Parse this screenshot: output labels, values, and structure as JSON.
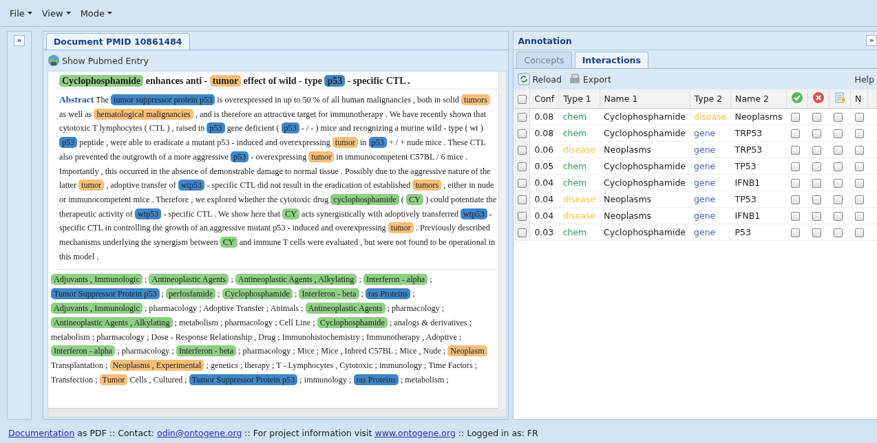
{
  "menu": [
    "File",
    "View",
    "Mode"
  ],
  "left_panel": {
    "expand_button": "»"
  },
  "document": {
    "tab": {
      "label": "Document PMID 10861484",
      "selected": true
    },
    "pubmed_button": "Show Pubmed Entry",
    "title": [
      {
        "text": "Cyclophosphamide",
        "kind": "chem"
      },
      {
        "text": "enhances anti -",
        "kind": "text"
      },
      {
        "text": "tumor",
        "kind": "disease"
      },
      {
        "text": "effect of wild - type",
        "kind": "text"
      },
      {
        "text": "p53",
        "kind": "gene"
      },
      {
        "text": "- specific   CTL   .",
        "kind": "text"
      }
    ],
    "abstract_label": "Abstract",
    "abstract": [
      {
        "text": "The",
        "kind": "text"
      },
      {
        "text": "tumor suppressor protein p53",
        "kind": "gene"
      },
      {
        "text": "is overexpressed in up to 50 % of all human malignancies , both in solid",
        "kind": "text"
      },
      {
        "text": "tumors",
        "kind": "disease"
      },
      {
        "text": "as well as",
        "kind": "text"
      },
      {
        "text": "hematological malignancies",
        "kind": "disease"
      },
      {
        "text": ", and is therefore an attractive target for immunotherapy . We have recently shown that cytotoxic T lymphocytes (   CTL   ) , raised in",
        "kind": "text"
      },
      {
        "text": "p53",
        "kind": "gene"
      },
      {
        "text": "gene deficient (",
        "kind": "text"
      },
      {
        "text": "p53",
        "kind": "gene"
      },
      {
        "text": "- / - ) mice and recognizing a murine wild - type ( wt )",
        "kind": "text"
      },
      {
        "text": "p53",
        "kind": "gene"
      },
      {
        "text": "peptide , were able to eradicate a mutant   p53   - induced and overexpressing",
        "kind": "text"
      },
      {
        "text": "tumor",
        "kind": "disease"
      },
      {
        "text": "in",
        "kind": "text"
      },
      {
        "text": "p53",
        "kind": "gene"
      },
      {
        "text": "+ / + nude mice . These   CTL   also prevented the outgrowth of a more aggressive",
        "kind": "text"
      },
      {
        "text": "p53",
        "kind": "gene"
      },
      {
        "text": "- overexpressing",
        "kind": "text"
      },
      {
        "text": "tumor",
        "kind": "disease"
      },
      {
        "text": "in immunocompetent C57BL / 6 mice . Importantly , this occurred in the absence of demonstrable damage to normal tissue . Possibly due to the aggressive nature of the latter",
        "kind": "text"
      },
      {
        "text": "tumor",
        "kind": "disease"
      },
      {
        "text": ", adoptive transfer of",
        "kind": "text"
      },
      {
        "text": "wtp53",
        "kind": "gene"
      },
      {
        "text": "- specific   CTL   did not result in the eradication of established",
        "kind": "text"
      },
      {
        "text": "tumors",
        "kind": "disease"
      },
      {
        "text": ", either in nude or immunocompetent mice . Therefore , we explored whether the cytotoxic drug",
        "kind": "text"
      },
      {
        "text": "cyclophosphamide",
        "kind": "chem"
      },
      {
        "text": "(",
        "kind": "text"
      },
      {
        "text": "CY",
        "kind": "chem"
      },
      {
        "text": ") could potentiate the therapeutic activity of",
        "kind": "text"
      },
      {
        "text": "wtp53",
        "kind": "gene"
      },
      {
        "text": "- specific   CTL   . We show here that",
        "kind": "text"
      },
      {
        "text": "CY",
        "kind": "chem"
      },
      {
        "text": "acts synergistically with adoptively transferred",
        "kind": "text"
      },
      {
        "text": "wtp53",
        "kind": "gene"
      },
      {
        "text": "- specific   CTL   in controlling the growth of an aggressive mutant p53 - induced and overexpressing",
        "kind": "text"
      },
      {
        "text": "tumor",
        "kind": "disease"
      },
      {
        "text": ". Previously described mechanisms underlying the synergism between",
        "kind": "text"
      },
      {
        "text": "CY",
        "kind": "chem"
      },
      {
        "text": "and immune T cells were evaluated , but were not found to be operational in this model .",
        "kind": "text"
      }
    ],
    "keywords": [
      {
        "text": "Adjuvants , Immunologic",
        "kind": "chem"
      },
      {
        "text": ";",
        "kind": "text"
      },
      {
        "text": "Antineoplastic Agents",
        "kind": "chem"
      },
      {
        "text": ";",
        "kind": "text"
      },
      {
        "text": "Antineoplastic Agents , Alkylating",
        "kind": "chem"
      },
      {
        "text": ";",
        "kind": "text"
      },
      {
        "text": "Interferon - alpha",
        "kind": "chem"
      },
      {
        "text": ";",
        "kind": "text"
      },
      {
        "text": "Tumor Suppressor Protein p53",
        "kind": "gene"
      },
      {
        "text": ";",
        "kind": "text"
      },
      {
        "text": "perfosfamide",
        "kind": "chem"
      },
      {
        "text": ";",
        "kind": "text"
      },
      {
        "text": "Cyclophosphamide",
        "kind": "chem"
      },
      {
        "text": ";",
        "kind": "text"
      },
      {
        "text": "Interferon - beta",
        "kind": "chem"
      },
      {
        "text": ";",
        "kind": "text"
      },
      {
        "text": "ras Proteins",
        "kind": "gene"
      },
      {
        "text": ";",
        "kind": "text"
      },
      {
        "text": "Adjuvants , Immunologic",
        "kind": "chem"
      },
      {
        "text": "; pharmacology ; Adoptive Transfer ; Animals ;",
        "kind": "text"
      },
      {
        "text": "Antineoplastic Agents",
        "kind": "chem"
      },
      {
        "text": "; pharmacology ;",
        "kind": "text"
      },
      {
        "text": "Antineoplastic Agents , Alkylating",
        "kind": "chem"
      },
      {
        "text": "; metabolism ; pharmacology ; Cell Line ;",
        "kind": "text"
      },
      {
        "text": "Cyclophosphamide",
        "kind": "chem"
      },
      {
        "text": "; analogs & derivatives ; metabolism ; pharmacology ; Dose - Response Relationship , Drug ; Immunohistochemistry ; Immunotherapy , Adoptive ;",
        "kind": "text"
      },
      {
        "text": "Interferon - alpha",
        "kind": "chem"
      },
      {
        "text": "; pharmacology ;",
        "kind": "text"
      },
      {
        "text": "Interferon - beta",
        "kind": "chem"
      },
      {
        "text": "; pharmacology ; Mice ; Mice , Inbred C57BL ; Mice , Nude ;",
        "kind": "text"
      },
      {
        "text": "Neoplasm",
        "kind": "disease"
      },
      {
        "text": "Transplantation ;",
        "kind": "text"
      },
      {
        "text": "Neoplasms , Experimental",
        "kind": "disease"
      },
      {
        "text": "; genetics ; therapy ; T - Lymphocytes , Cytotoxic ; immunology ; Time Factors ; Transfection ;",
        "kind": "text"
      },
      {
        "text": "Tumor",
        "kind": "disease"
      },
      {
        "text": "Cells , Cultured ;",
        "kind": "text"
      },
      {
        "text": "Tumor Suppressor Protein p53",
        "kind": "gene"
      },
      {
        "text": "; immunology ;",
        "kind": "text"
      },
      {
        "text": "ras Proteins",
        "kind": "gene"
      },
      {
        "text": "; metabolism ;",
        "kind": "text"
      }
    ]
  },
  "annotation": {
    "title": "Annotation",
    "expand_button": "»",
    "tabs": [
      {
        "label": "Concepts",
        "selected": false
      },
      {
        "label": "Interactions",
        "selected": true
      }
    ],
    "toolbar": {
      "reload": "Reload",
      "export": "Export",
      "help": "Help"
    },
    "table": {
      "all_selected": false,
      "columns": [
        "Conf",
        "Type 1",
        "Name 1",
        "Type 2",
        "Name 2",
        "N"
      ],
      "rows": [
        {
          "selected": false,
          "conf": "0.08",
          "type1": "chem",
          "name1": "Cyclophosphamide",
          "type2": "disease",
          "name2": "Neoplasms",
          "checks": [
            false,
            false,
            false,
            false
          ]
        },
        {
          "selected": false,
          "conf": "0.08",
          "type1": "chem",
          "name1": "Cyclophosphamide",
          "type2": "gene",
          "name2": "TRP53",
          "checks": [
            false,
            false,
            false,
            false
          ]
        },
        {
          "selected": false,
          "conf": "0.06",
          "type1": "disease",
          "name1": "Neoplasms",
          "type2": "gene",
          "name2": "TRP53",
          "checks": [
            false,
            false,
            false,
            false
          ]
        },
        {
          "selected": false,
          "conf": "0.05",
          "type1": "chem",
          "name1": "Cyclophosphamide",
          "type2": "gene",
          "name2": "TP53",
          "checks": [
            false,
            false,
            false,
            false
          ]
        },
        {
          "selected": false,
          "conf": "0.04",
          "type1": "chem",
          "name1": "Cyclophosphamide",
          "type2": "gene",
          "name2": "IFNB1",
          "checks": [
            false,
            false,
            false,
            false
          ]
        },
        {
          "selected": false,
          "conf": "0.04",
          "type1": "disease",
          "name1": "Neoplasms",
          "type2": "gene",
          "name2": "TP53",
          "checks": [
            false,
            false,
            false,
            false
          ]
        },
        {
          "selected": false,
          "conf": "0.04",
          "type1": "disease",
          "name1": "Neoplasms",
          "type2": "gene",
          "name2": "IFNB1",
          "checks": [
            false,
            false,
            false,
            false
          ]
        },
        {
          "selected": false,
          "conf": "0.03",
          "type1": "chem",
          "name1": "Cyclophosphamide",
          "type2": "gene",
          "name2": "P53",
          "checks": [
            false,
            false,
            false,
            false
          ]
        }
      ]
    }
  },
  "footer": [
    {
      "text": "Documentation",
      "kind": "link"
    },
    {
      "text": "as PDF :: Contact:",
      "kind": "text"
    },
    {
      "text": "odin@ontogene.org",
      "kind": "link"
    },
    {
      "text": "::  For project information visit",
      "kind": "text"
    },
    {
      "text": "www.ontogene.org",
      "kind": "link"
    },
    {
      "text": ":: Logged in as: FR",
      "kind": "text"
    }
  ]
}
